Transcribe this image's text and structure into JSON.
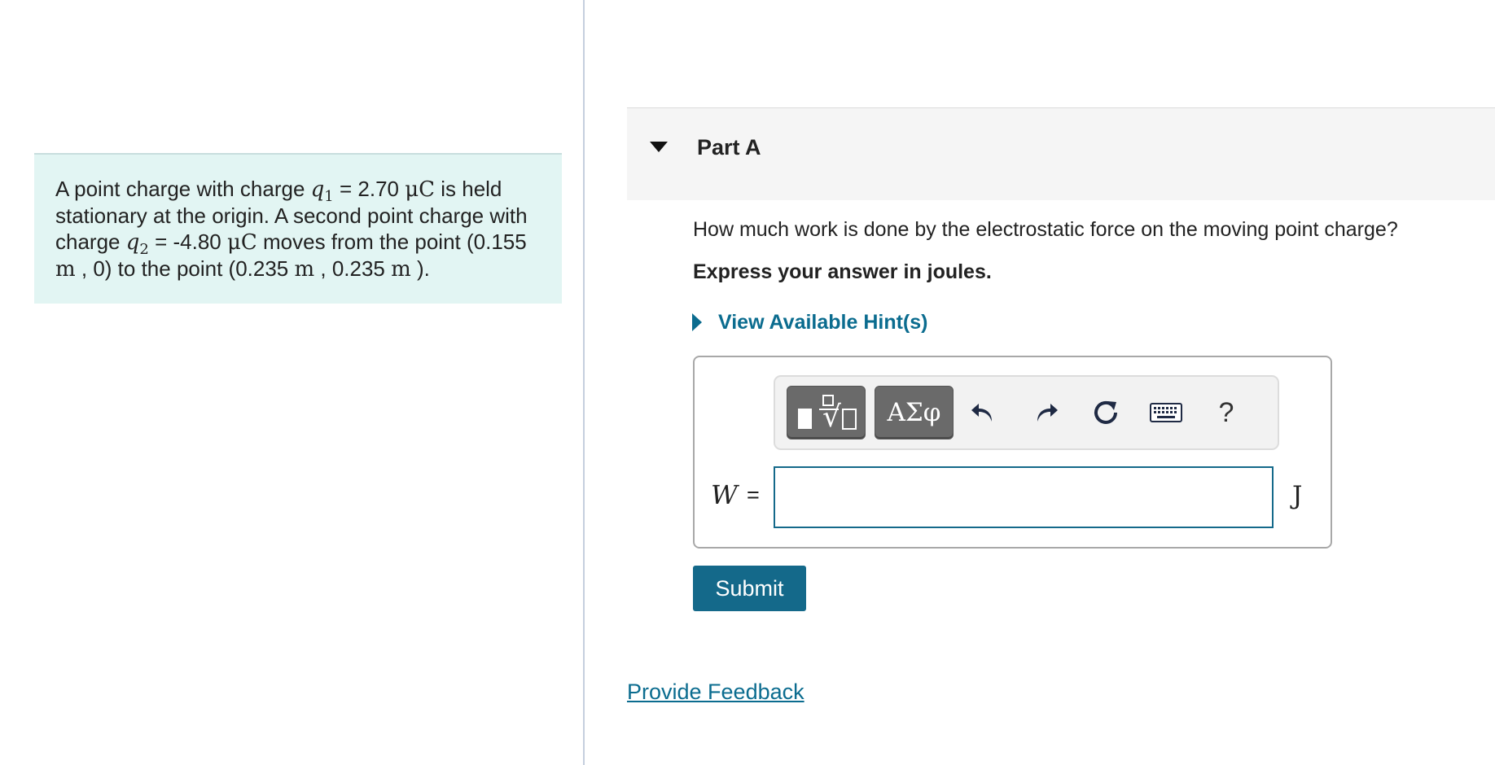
{
  "problem": {
    "text_a": "A point charge with charge ",
    "q1_symbol": "q",
    "q1_sub": "1",
    "eq1": " = 2.70 ",
    "unit_micro_coulomb": "μC",
    "text_b": " is held stationary at the origin. A second point charge with charge ",
    "q2_symbol": "q",
    "q2_sub": "2",
    "eq2": " = -4.80 ",
    "text_c": " moves from the point (0.155 ",
    "unit_m": "m",
    "text_d": " , 0) to the point (0.235 ",
    "text_e": " , 0.235 ",
    "text_f": " )."
  },
  "part": {
    "title": "Part A",
    "question": "How much work is done by the electrostatic force on the moving point charge?",
    "instruction": "Express your answer in joules.",
    "hint_label": "View Available Hint(s)"
  },
  "toolbar": {
    "symbols_label": "ΑΣφ",
    "help_label": "?",
    "icons": [
      "templates-icon",
      "symbols-icon",
      "undo-icon",
      "redo-icon",
      "reset-icon",
      "keyboard-icon",
      "help-icon"
    ]
  },
  "answer": {
    "variable": "W",
    "equals": "=",
    "value": "",
    "unit": "J"
  },
  "actions": {
    "submit_label": "Submit",
    "feedback_label": "Provide Feedback"
  },
  "colors": {
    "accent": "#14698a",
    "link": "#0b6c8f",
    "problem_bg": "#e2f5f3",
    "header_bg": "#f5f5f5",
    "toolbar_button": "#6a6a6a"
  }
}
